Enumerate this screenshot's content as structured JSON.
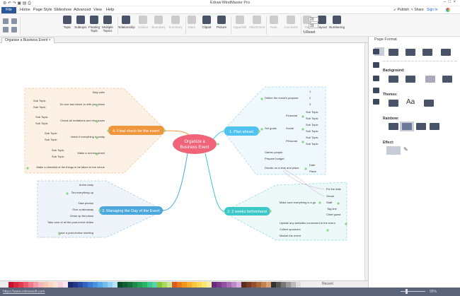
{
  "app": {
    "title": "Edraw MindMaster Pro"
  },
  "menu": {
    "file": "File",
    "items": [
      "Home",
      "Page Style",
      "Slideshow",
      "Advanced",
      "View",
      "Help"
    ]
  },
  "account": {
    "publish": "Publish",
    "share": "Share",
    "sign_in": "Sign In"
  },
  "ribbon": {
    "buttons": [
      {
        "label": "Topic",
        "enabled": true
      },
      {
        "label": "Subtopic",
        "enabled": true
      },
      {
        "label": "Floating Topic",
        "enabled": true
      },
      {
        "label": "Multiple Topics",
        "enabled": true
      },
      {
        "label": "Relationship",
        "enabled": true
      },
      {
        "label": "Callout",
        "enabled": false
      },
      {
        "label": "Boundary",
        "enabled": false
      },
      {
        "label": "Summary",
        "enabled": false
      },
      {
        "label": "Mark",
        "enabled": false
      },
      {
        "label": "Clipart",
        "enabled": true
      },
      {
        "label": "Picture",
        "enabled": true
      },
      {
        "label": "Hyperlink",
        "enabled": false
      },
      {
        "label": "Attachment",
        "enabled": false
      },
      {
        "label": "Note",
        "enabled": false
      },
      {
        "label": "Comment",
        "enabled": false
      },
      {
        "label": "Tag",
        "enabled": false
      },
      {
        "label": "Layout",
        "enabled": true
      },
      {
        "label": "Numbering",
        "enabled": true
      }
    ],
    "spacing_h": "20",
    "spacing_v": "33",
    "reset": "Reset"
  },
  "document_tab": "Organise a Business Event",
  "mindmap": {
    "central": [
      "Organize a",
      "Business Event"
    ],
    "branch1": {
      "label": "1. Plan  ahead",
      "purpose": "Define the event's purpose",
      "purpose_items": [
        "1",
        "2",
        "3"
      ],
      "goals": "Set goals",
      "financial": "Financial",
      "social": "Social",
      "personal": "Personal",
      "sub": "Sub Topic",
      "gather": "Gather people",
      "budget": "Prepare budget",
      "decide": "Decide on a time and place",
      "date": "Date",
      "place": "Place"
    },
    "branch2": {
      "label": "2.  2 weeks beforehand",
      "go": "Make sure everything is a go",
      "go_items": [
        "Fix the date",
        "Venue",
        "Staff",
        "Tag line",
        "Chief guest"
      ],
      "websites": "Update any websites connected to the event",
      "sponsors": "Collect sponsors",
      "market": "Market the event"
    },
    "branch3": {
      "label": "3. Managing the Day of the Event",
      "items": [
        "Arrive early",
        "Set everything up",
        "Take photos",
        "Give a takeaway",
        "Clean up the place",
        "Take care of all the post-event duties",
        "Have a post-review meeting"
      ]
    },
    "branch4": {
      "label": "4. Final check for the event",
      "calm": "Stay calm",
      "items": [
        "Do one last check-in with your team",
        "Check all invitations and responses",
        "check if everything is ready",
        "Make a running sheet"
      ],
      "sub": "Sub Topic",
      "checklist": "Make a checklist of the things to be taken to the venue"
    }
  },
  "panel": {
    "title": "Page Format",
    "background": "Background:",
    "themes": "Themes:",
    "rainbow": "Rainbow:",
    "effect": "Effect:"
  },
  "palette": {
    "recent": "Recent"
  },
  "status": {
    "url": "https://www.edrawsoft.com",
    "zoom": "95%"
  },
  "colors": {
    "central": "#f0647a",
    "branch1": "#4fc3f0",
    "branch2": "#3cc8c8",
    "branch3": "#4aa8dc",
    "branch4": "#f0963c",
    "file": "#2b579a",
    "status": "#5b6379"
  }
}
